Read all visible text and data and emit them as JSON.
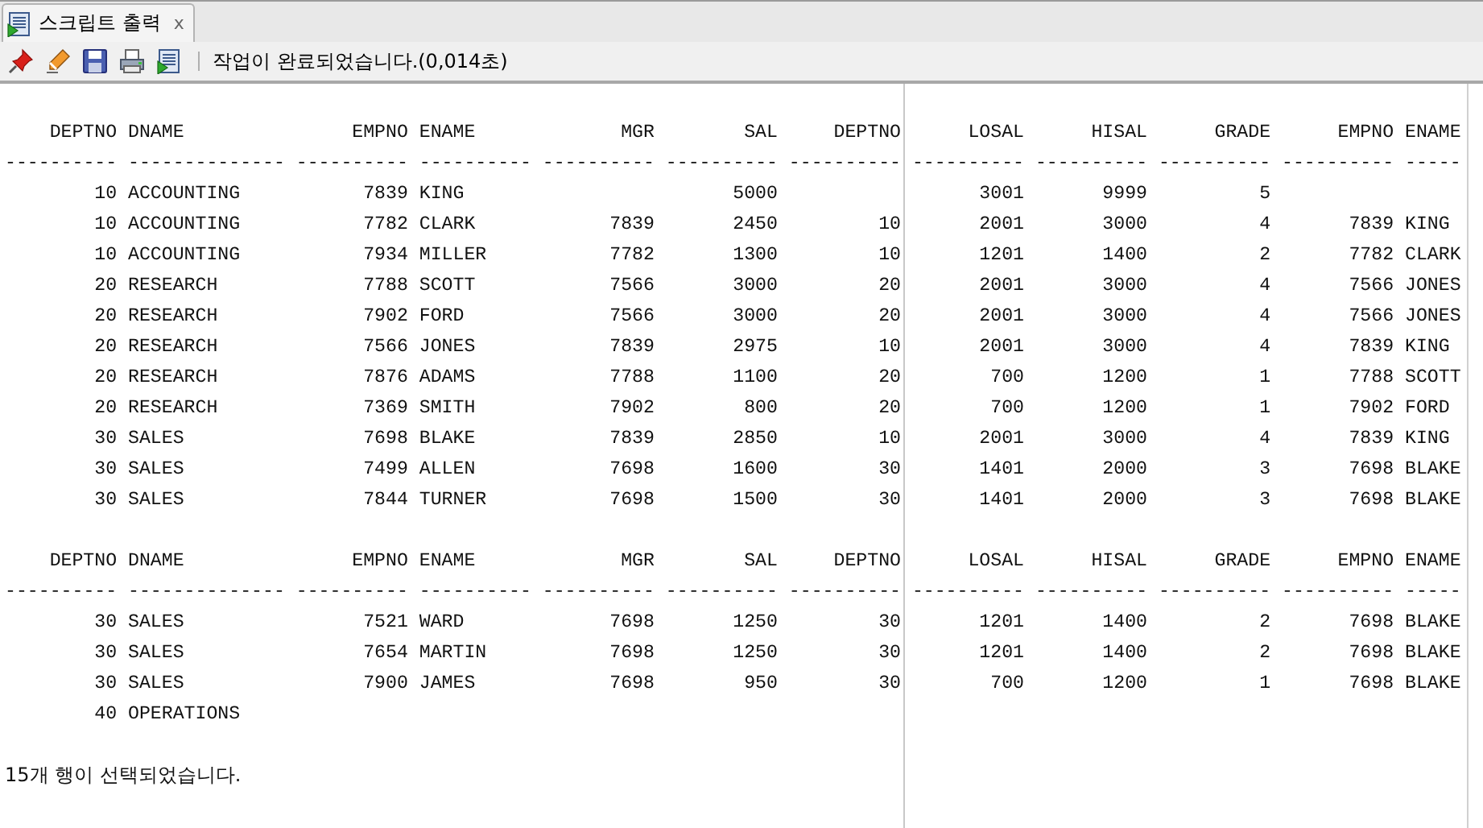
{
  "tab": {
    "title": "스크립트 출력",
    "close": "x",
    "selected": true
  },
  "toolbar": {
    "status": "작업이 완료되었습니다.(0,014초)"
  },
  "output": {
    "blocks": [
      {
        "columns": [
          {
            "heading": "DEPTNO",
            "rule": "----------",
            "kind": "number"
          },
          {
            "heading": "DNAME",
            "rule": "--------------",
            "kind": "text"
          },
          {
            "heading": "EMPNO",
            "rule": "----------",
            "kind": "number"
          },
          {
            "heading": "ENAME",
            "rule": "----------",
            "kind": "text"
          },
          {
            "heading": "MGR",
            "rule": "----------",
            "kind": "number"
          },
          {
            "heading": "SAL",
            "rule": "----------",
            "kind": "number"
          },
          {
            "heading": "DEPTNO",
            "rule": "----------",
            "kind": "number"
          },
          {
            "heading": "LOSAL",
            "rule": "----------",
            "kind": "number"
          },
          {
            "heading": "HISAL",
            "rule": "----------",
            "kind": "number"
          },
          {
            "heading": "GRADE",
            "rule": "----------",
            "kind": "number"
          },
          {
            "heading": "EMPNO",
            "rule": "----------",
            "kind": "number"
          },
          {
            "heading": "ENAME",
            "rule": "-----",
            "kind": "text"
          }
        ],
        "rows": [
          [
            "10",
            "ACCOUNTING",
            "7839",
            "KING",
            null,
            "5000",
            null,
            "3001",
            "9999",
            "5",
            null,
            null
          ],
          [
            "10",
            "ACCOUNTING",
            "7782",
            "CLARK",
            "7839",
            "2450",
            "10",
            "2001",
            "3000",
            "4",
            "7839",
            "KING"
          ],
          [
            "10",
            "ACCOUNTING",
            "7934",
            "MILLER",
            "7782",
            "1300",
            "10",
            "1201",
            "1400",
            "2",
            "7782",
            "CLARK"
          ],
          [
            "20",
            "RESEARCH",
            "7788",
            "SCOTT",
            "7566",
            "3000",
            "20",
            "2001",
            "3000",
            "4",
            "7566",
            "JONES"
          ],
          [
            "20",
            "RESEARCH",
            "7902",
            "FORD",
            "7566",
            "3000",
            "20",
            "2001",
            "3000",
            "4",
            "7566",
            "JONES"
          ],
          [
            "20",
            "RESEARCH",
            "7566",
            "JONES",
            "7839",
            "2975",
            "10",
            "2001",
            "3000",
            "4",
            "7839",
            "KING"
          ],
          [
            "20",
            "RESEARCH",
            "7876",
            "ADAMS",
            "7788",
            "1100",
            "20",
            "700",
            "1200",
            "1",
            "7788",
            "SCOTT"
          ],
          [
            "20",
            "RESEARCH",
            "7369",
            "SMITH",
            "7902",
            "800",
            "20",
            "700",
            "1200",
            "1",
            "7902",
            "FORD"
          ],
          [
            "30",
            "SALES",
            "7698",
            "BLAKE",
            "7839",
            "2850",
            "10",
            "2001",
            "3000",
            "4",
            "7839",
            "KING"
          ],
          [
            "30",
            "SALES",
            "7499",
            "ALLEN",
            "7698",
            "1600",
            "30",
            "1401",
            "2000",
            "3",
            "7698",
            "BLAKE"
          ],
          [
            "30",
            "SALES",
            "7844",
            "TURNER",
            "7698",
            "1500",
            "30",
            "1401",
            "2000",
            "3",
            "7698",
            "BLAKE"
          ]
        ]
      },
      {
        "columns": [
          {
            "heading": "DEPTNO",
            "rule": "----------",
            "kind": "number"
          },
          {
            "heading": "DNAME",
            "rule": "--------------",
            "kind": "text"
          },
          {
            "heading": "EMPNO",
            "rule": "----------",
            "kind": "number"
          },
          {
            "heading": "ENAME",
            "rule": "----------",
            "kind": "text"
          },
          {
            "heading": "MGR",
            "rule": "----------",
            "kind": "number"
          },
          {
            "heading": "SAL",
            "rule": "----------",
            "kind": "number"
          },
          {
            "heading": "DEPTNO",
            "rule": "----------",
            "kind": "number"
          },
          {
            "heading": "LOSAL",
            "rule": "----------",
            "kind": "number"
          },
          {
            "heading": "HISAL",
            "rule": "----------",
            "kind": "number"
          },
          {
            "heading": "GRADE",
            "rule": "----------",
            "kind": "number"
          },
          {
            "heading": "EMPNO",
            "rule": "----------",
            "kind": "number"
          },
          {
            "heading": "ENAME",
            "rule": "-----",
            "kind": "text"
          }
        ],
        "rows": [
          [
            "30",
            "SALES",
            "7521",
            "WARD",
            "7698",
            "1250",
            "30",
            "1201",
            "1400",
            "2",
            "7698",
            "BLAKE"
          ],
          [
            "30",
            "SALES",
            "7654",
            "MARTIN",
            "7698",
            "1250",
            "30",
            "1201",
            "1400",
            "2",
            "7698",
            "BLAKE"
          ],
          [
            "30",
            "SALES",
            "7900",
            "JAMES",
            "7698",
            "950",
            "30",
            "700",
            "1200",
            "1",
            "7698",
            "BLAKE"
          ],
          [
            "40",
            "OPERATIONS",
            null,
            null,
            null,
            null,
            null,
            null,
            null,
            null,
            null,
            null
          ]
        ]
      }
    ],
    "footer": "15개 행이 선택되었습니다."
  }
}
